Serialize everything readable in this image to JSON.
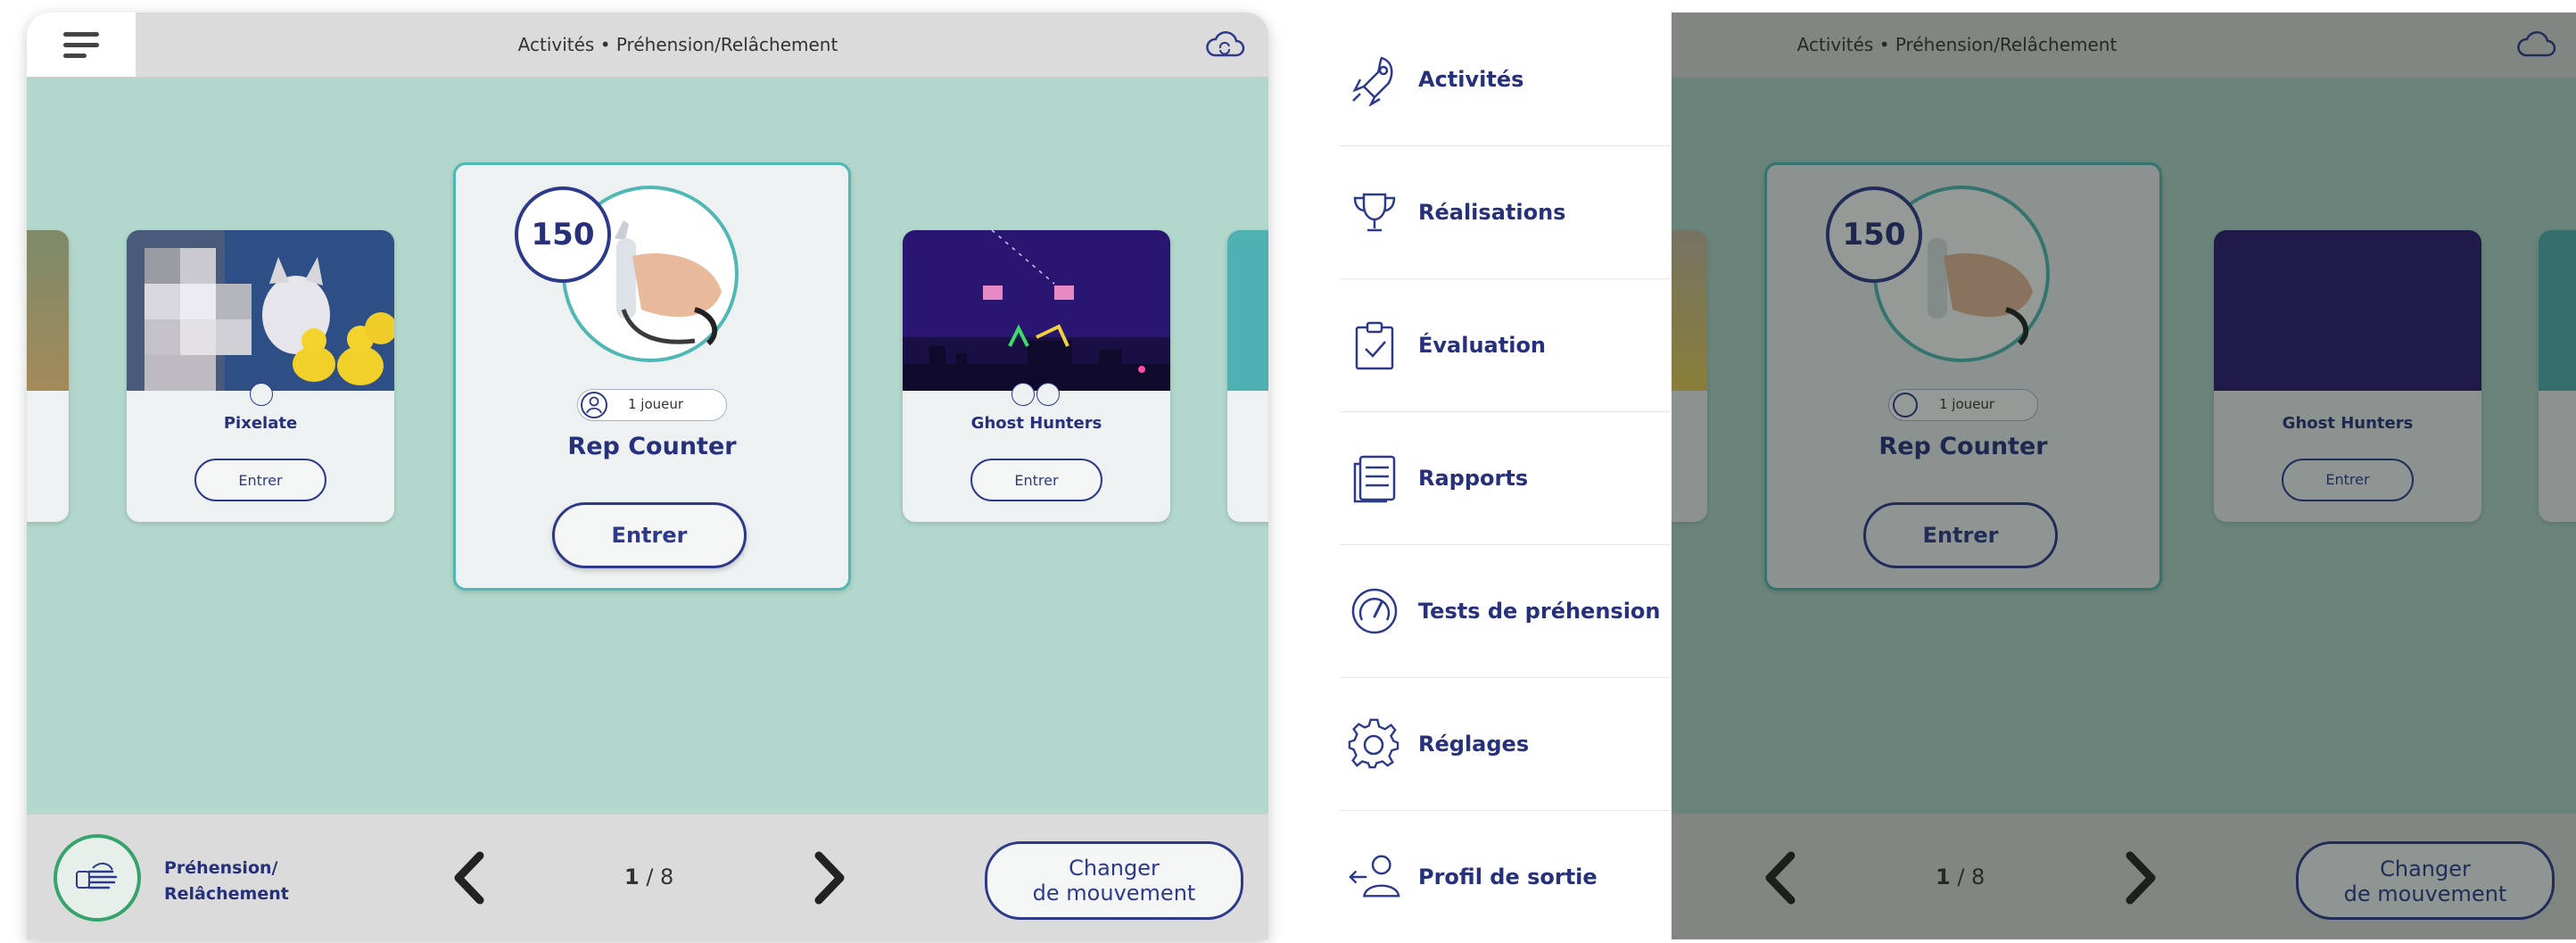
{
  "header": {
    "title": "Activités • Préhension/Relâchement"
  },
  "cards": {
    "pixelate": {
      "name": "Pixelate",
      "button": "Entrer"
    },
    "rep_counter": {
      "name": "Rep Counter",
      "count": "150",
      "players": "1 joueur",
      "button": "Entrer"
    },
    "ghost_hunters": {
      "name": "Ghost Hunters",
      "button": "Entrer"
    }
  },
  "footer": {
    "movement_line1": "Préhension/",
    "movement_line2": "Relâchement",
    "page_current": "1",
    "page_total": "/ 8",
    "change_line1": "Changer",
    "change_line2": "de mouvement"
  },
  "menu": {
    "items": [
      {
        "label": "Activités",
        "icon": "rocket-icon"
      },
      {
        "label": "Réalisations",
        "icon": "trophy-icon"
      },
      {
        "label": "Évaluation",
        "icon": "clipboard-check-icon"
      },
      {
        "label": "Rapports",
        "icon": "report-list-icon"
      },
      {
        "label": "Tests de préhension",
        "icon": "gauge-icon"
      },
      {
        "label": "Réglages",
        "icon": "gear-icon"
      },
      {
        "label": "Profil de sortie",
        "icon": "logout-profile-icon"
      }
    ]
  },
  "colors": {
    "accent": "#27307a",
    "teal": "#4fb8b4",
    "background": "#b2d7cc",
    "green_ring": "#35a36a"
  }
}
